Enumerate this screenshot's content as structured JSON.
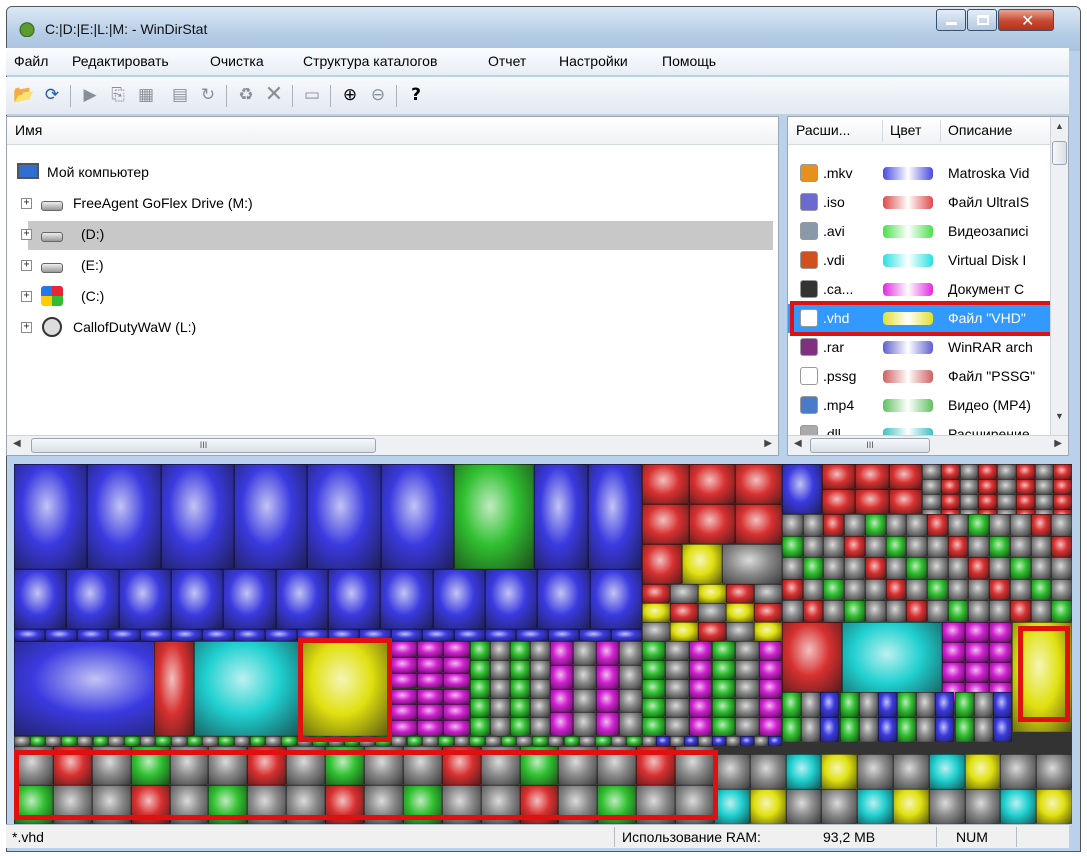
{
  "window": {
    "title": "C:|D:|E:|L:|M: - WinDirStat"
  },
  "menu": [
    "Файл",
    "Редактировать",
    "Очистка",
    "Структура каталогов",
    "Отчет",
    "Настройки",
    "Помощь"
  ],
  "toolbar": {
    "icons": [
      "open-folder-icon",
      "refresh-icon",
      "play-icon",
      "copy-path-icon",
      "explorer-icon",
      "command-prompt-icon",
      "refresh-selected-icon",
      "recycle-bin-icon",
      "delete-icon",
      "properties-icon",
      "zoom-in-icon",
      "zoom-out-icon",
      "help-icon"
    ]
  },
  "tree": {
    "header": "Имя",
    "root": "Мой компьютер",
    "items": [
      {
        "label": "FreeAgent GoFlex Drive (M:)",
        "icon": "drive-icon"
      },
      {
        "label": "(D:)",
        "icon": "drive-icon",
        "selected": true
      },
      {
        "label": "(E:)",
        "icon": "drive-icon"
      },
      {
        "label": "(C:)",
        "icon": "windows-drive-icon"
      },
      {
        "label": "CallofDutyWaW (L:)",
        "icon": "cd-drive-icon"
      }
    ],
    "scroll_glyph": "III"
  },
  "extensions": {
    "headers": [
      "Расши...",
      "Цвет",
      "Описание"
    ],
    "rows": [
      {
        "ext": ".mkv",
        "color": "#4a4ae0",
        "desc": "Matroska Vid",
        "icon_color": "#e8901c"
      },
      {
        "ext": ".iso",
        "color": "#e04a4a",
        "desc": "Файл UltraIS",
        "icon_color": "#6a6ad0"
      },
      {
        "ext": ".avi",
        "color": "#4ae04a",
        "desc": "Видеозаписі",
        "icon_color": "#8899aa"
      },
      {
        "ext": ".vdi",
        "color": "#2ae0e0",
        "desc": "Virtual Disk I",
        "icon_color": "#d05020"
      },
      {
        "ext": ".ca...",
        "color": "#e02ae0",
        "desc": "Документ С",
        "icon_color": "#333333"
      },
      {
        "ext": ".vhd",
        "color": "#e0e02a",
        "desc": "Файл \"VHD\"",
        "icon_color": "#ffffff",
        "selected": true
      },
      {
        "ext": ".rar",
        "color": "#6060d0",
        "desc": "WinRAR arch",
        "icon_color": "#803080"
      },
      {
        "ext": ".pssg",
        "color": "#d06060",
        "desc": "Файл \"PSSG\"",
        "icon_color": "#ffffff"
      },
      {
        "ext": ".mp4",
        "color": "#60c060",
        "desc": "Видео (MP4)",
        "icon_color": "#4a7acc"
      },
      {
        "ext": ".dll",
        "color": "#40c0c0",
        "desc": "Расширение",
        "icon_color": "#aaaaaa"
      }
    ],
    "scroll_glyph": "III"
  },
  "status": {
    "filter": "*.vhd",
    "ram_label": "Использование RAM:",
    "ram_value": "93,2 MB",
    "num": "NUM"
  },
  "colors": {
    "blue": "#3a3ae0",
    "red": "#d83030",
    "green": "#30c030",
    "cyan": "#20d0d0",
    "magenta": "#d020d0",
    "yellow": "#e0e010",
    "gray": "#8a8a8a",
    "highlight": "#e01010"
  }
}
